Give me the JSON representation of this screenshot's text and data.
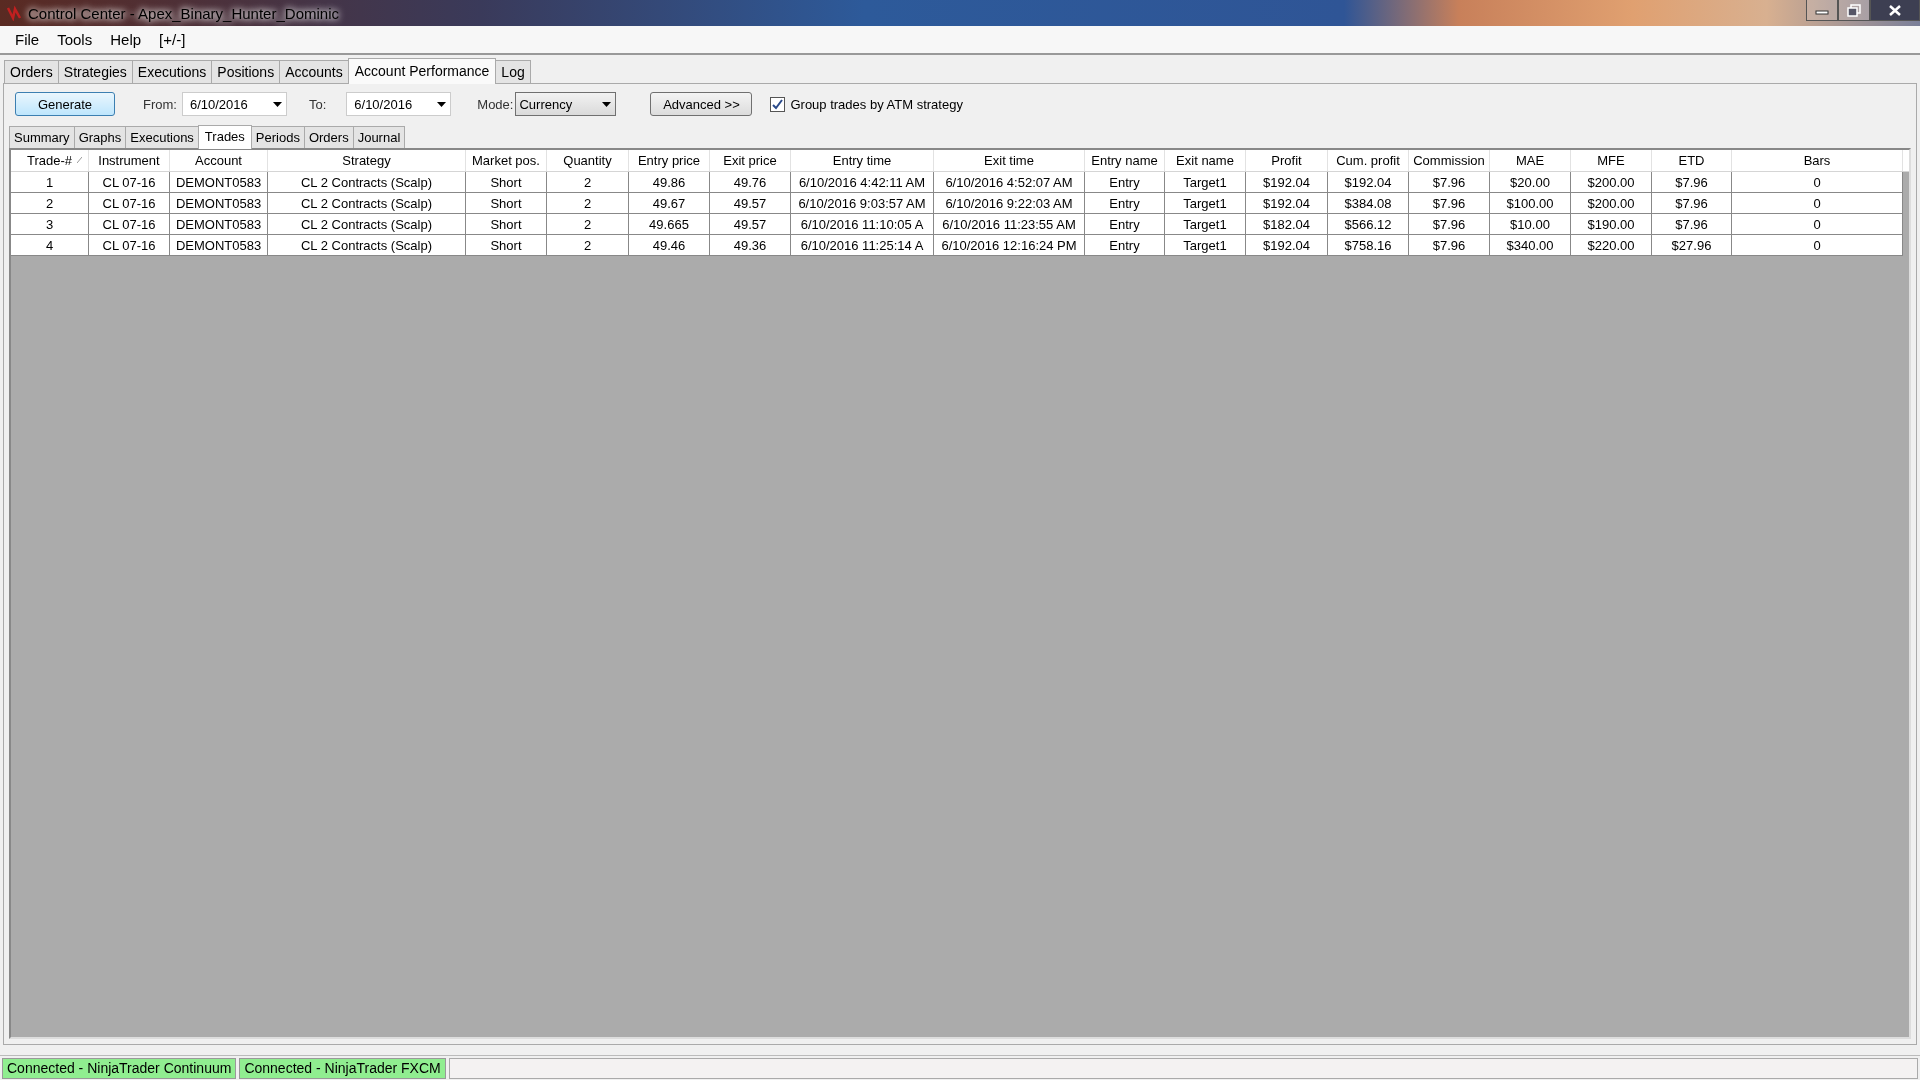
{
  "window": {
    "title": "Control Center - Apex_Binary_Hunter_Dominic"
  },
  "menu": [
    "File",
    "Tools",
    "Help",
    "[+/-]"
  ],
  "tabs": [
    {
      "label": "Orders",
      "selected": false
    },
    {
      "label": "Strategies",
      "selected": false
    },
    {
      "label": "Executions",
      "selected": false
    },
    {
      "label": "Positions",
      "selected": false
    },
    {
      "label": "Accounts",
      "selected": false
    },
    {
      "label": "Account Performance",
      "selected": true
    },
    {
      "label": "Log",
      "selected": false
    }
  ],
  "toolbar": {
    "generate": "Generate",
    "from_label": "From:",
    "from_value": "6/10/2016",
    "to_label": "To:",
    "to_value": "6/10/2016",
    "mode_label": "Mode:",
    "mode_value": "Currency",
    "advanced": "Advanced >>",
    "group_label": "Group trades by ATM strategy",
    "group_checked": true
  },
  "subtabs": [
    {
      "label": "Summary",
      "selected": false
    },
    {
      "label": "Graphs",
      "selected": false
    },
    {
      "label": "Executions",
      "selected": false
    },
    {
      "label": "Trades",
      "selected": true
    },
    {
      "label": "Periods",
      "selected": false
    },
    {
      "label": "Orders",
      "selected": false
    },
    {
      "label": "Journal",
      "selected": false
    }
  ],
  "table": {
    "columns": [
      {
        "label": "Trade-#",
        "sorted": true
      },
      {
        "label": "Instrument",
        "sorted": false
      },
      {
        "label": "Account",
        "sorted": false
      },
      {
        "label": "Strategy",
        "sorted": false
      },
      {
        "label": "Market pos.",
        "sorted": false
      },
      {
        "label": "Quantity",
        "sorted": false
      },
      {
        "label": "Entry price",
        "sorted": false
      },
      {
        "label": "Exit price",
        "sorted": false
      },
      {
        "label": "Entry time",
        "sorted": false
      },
      {
        "label": "Exit time",
        "sorted": false
      },
      {
        "label": "Entry name",
        "sorted": false
      },
      {
        "label": "Exit name",
        "sorted": false
      },
      {
        "label": "Profit",
        "sorted": false
      },
      {
        "label": "Cum. profit",
        "sorted": false
      },
      {
        "label": "Commission",
        "sorted": false
      },
      {
        "label": "MAE",
        "sorted": false
      },
      {
        "label": "MFE",
        "sorted": false
      },
      {
        "label": "ETD",
        "sorted": false
      },
      {
        "label": "Bars",
        "sorted": false
      }
    ],
    "rows": [
      [
        "1",
        "CL 07-16",
        "DEMONT0583",
        "CL 2 Contracts (Scalp)",
        "Short",
        "2",
        "49.86",
        "49.76",
        "6/10/2016 4:42:11 AM",
        "6/10/2016 4:52:07 AM",
        "Entry",
        "Target1",
        "$192.04",
        "$192.04",
        "$7.96",
        "$20.00",
        "$200.00",
        "$7.96",
        "0"
      ],
      [
        "2",
        "CL 07-16",
        "DEMONT0583",
        "CL 2 Contracts (Scalp)",
        "Short",
        "2",
        "49.67",
        "49.57",
        "6/10/2016 9:03:57 AM",
        "6/10/2016 9:22:03 AM",
        "Entry",
        "Target1",
        "$192.04",
        "$384.08",
        "$7.96",
        "$100.00",
        "$200.00",
        "$7.96",
        "0"
      ],
      [
        "3",
        "CL 07-16",
        "DEMONT0583",
        "CL 2 Contracts (Scalp)",
        "Short",
        "2",
        "49.665",
        "49.57",
        "6/10/2016 11:10:05 A",
        "6/10/2016 11:23:55 AM",
        "Entry",
        "Target1",
        "$182.04",
        "$566.12",
        "$7.96",
        "$10.00",
        "$190.00",
        "$7.96",
        "0"
      ],
      [
        "4",
        "CL 07-16",
        "DEMONT0583",
        "CL 2 Contracts (Scalp)",
        "Short",
        "2",
        "49.46",
        "49.36",
        "6/10/2016 11:25:14 A",
        "6/10/2016 12:16:24 PM",
        "Entry",
        "Target1",
        "$192.04",
        "$758.16",
        "$7.96",
        "$340.00",
        "$220.00",
        "$27.96",
        "0"
      ]
    ]
  },
  "status_bar": [
    {
      "text": "Connected - NinjaTrader Continuum",
      "color": "#90ee90"
    },
    {
      "text": "Connected - NinjaTrader FXCM",
      "color": "#90ee90"
    }
  ]
}
